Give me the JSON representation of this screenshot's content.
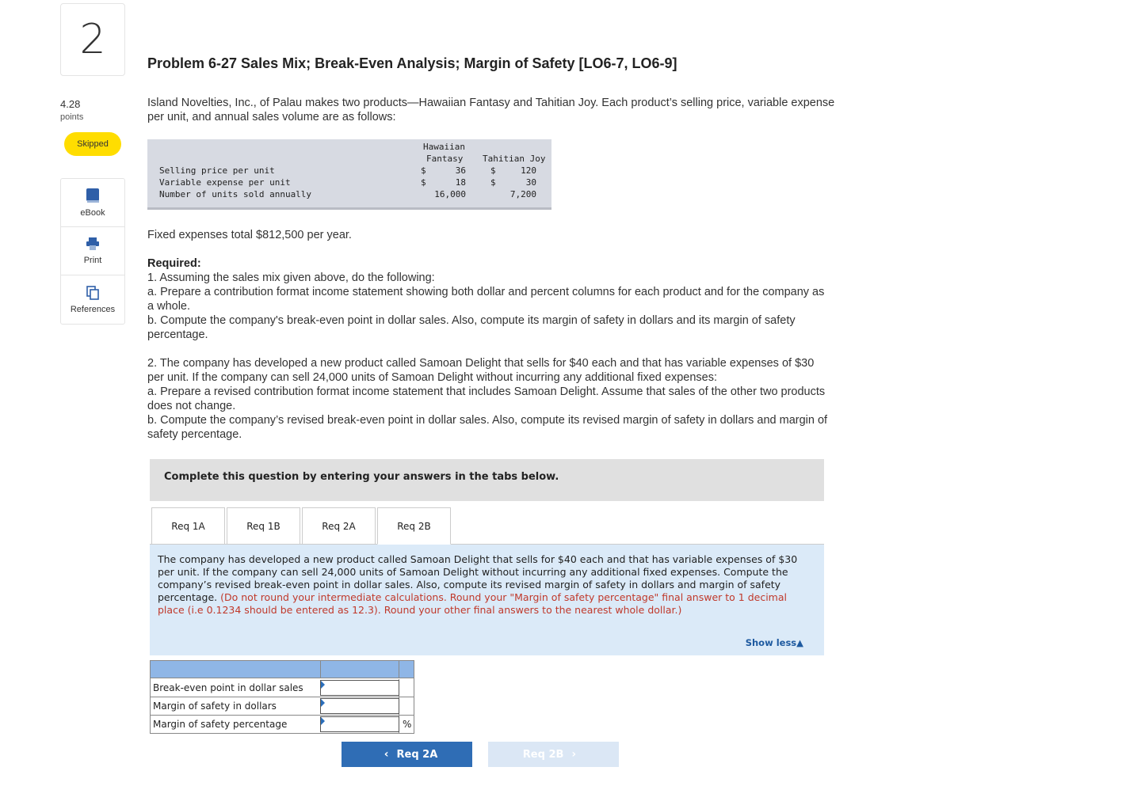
{
  "question": {
    "number": "2",
    "points_value": "4.28",
    "points_label": "points",
    "status": "Skipped"
  },
  "tools": [
    {
      "label": "eBook",
      "icon": "book-icon"
    },
    {
      "label": "Print",
      "icon": "printer-icon"
    },
    {
      "label": "References",
      "icon": "copy-icon"
    }
  ],
  "problem": {
    "title": "Problem 6-27 Sales Mix; Break-Even Analysis; Margin of Safety [LO6-7, LO6-9]",
    "intro_1": "Island Novelties, Inc., of Palau makes two products—Hawaiian Fantasy and Tahitian Joy. Each product’s selling price, variable expense",
    "intro_2": "per unit, and annual sales volume are as follows:",
    "fixed_expenses": "Fixed expenses total $812,500 per year.",
    "required_heading": "Required:",
    "req1": "1. Assuming the sales mix given above, do the following:",
    "req1a_1": "a. Prepare a contribution format income statement showing both dollar and percent columns for each product and for the company as",
    "req1a_2": "a whole.",
    "req1b_1": "b. Compute the company's break-even point in dollar sales. Also, compute its margin of safety in dollars and its margin of safety",
    "req1b_2": "percentage.",
    "req2_1": "2. The company has developed a new product called Samoan Delight that sells for $40 each and that has variable expenses of $30",
    "req2_2": "per unit. If the company can sell 24,000 units of Samoan Delight without incurring any additional fixed expenses:",
    "req2a_1": "a. Prepare a revised contribution format income statement that includes Samoan Delight. Assume that sales of the other two products",
    "req2a_2": "does not change.",
    "req2b_1": "b. Compute the company’s revised break-even point in dollar sales. Also, compute its revised margin of safety in dollars and margin of",
    "req2b_2": "safety percentage."
  },
  "product_table": {
    "col1_header_line1": "Hawaiian",
    "col1_header_line2": "Fantasy",
    "col2_header": "Tahitian Joy",
    "rows": [
      {
        "label": "Selling price per unit",
        "c1_sym": "$",
        "c1": "36",
        "c2_sym": "$",
        "c2": "120"
      },
      {
        "label": "Variable expense per unit",
        "c1_sym": "$",
        "c1": "18",
        "c2_sym": "$",
        "c2": "30"
      },
      {
        "label": "Number of units sold annually",
        "c1_sym": "",
        "c1": "16,000",
        "c2_sym": "",
        "c2": "7,200"
      }
    ]
  },
  "instructions": "Complete this question by entering your answers in the tabs below.",
  "tabs": [
    "Req 1A",
    "Req 1B",
    "Req 2A",
    "Req 2B"
  ],
  "active_tab": "Req 2B",
  "req_panel": {
    "text": "The company has developed a new product called Samoan Delight that sells for $40 each and that has variable expenses of $30 per unit. If the company can sell 24,000 units of Samoan Delight without incurring any additional fixed expenses. Compute the company’s revised break-even point in dollar sales. Also, compute its revised margin of safety in dollars and margin of safety percentage.",
    "note": "(Do not round your intermediate calculations.  Round your \"Margin of safety percentage\" final answer to 1 decimal place (i.e 0.1234 should be entered as 12.3).  Round your other final answers to the nearest whole dollar.)",
    "show_less": "Show less"
  },
  "answer_table": {
    "rows": [
      {
        "label": "Break-even point in dollar sales",
        "value": "",
        "unit": ""
      },
      {
        "label": "Margin of safety in dollars",
        "value": "",
        "unit": ""
      },
      {
        "label": "Margin of safety percentage",
        "value": "",
        "unit": "%"
      }
    ]
  },
  "nav": {
    "prev_label": "Req 2A",
    "next_label": "Req 2B"
  },
  "colors": {
    "accent": "#2f6db5",
    "skipped_badge": "#ffdd00",
    "note_red": "#c0392b",
    "panel_bg": "#dbeaf8"
  }
}
